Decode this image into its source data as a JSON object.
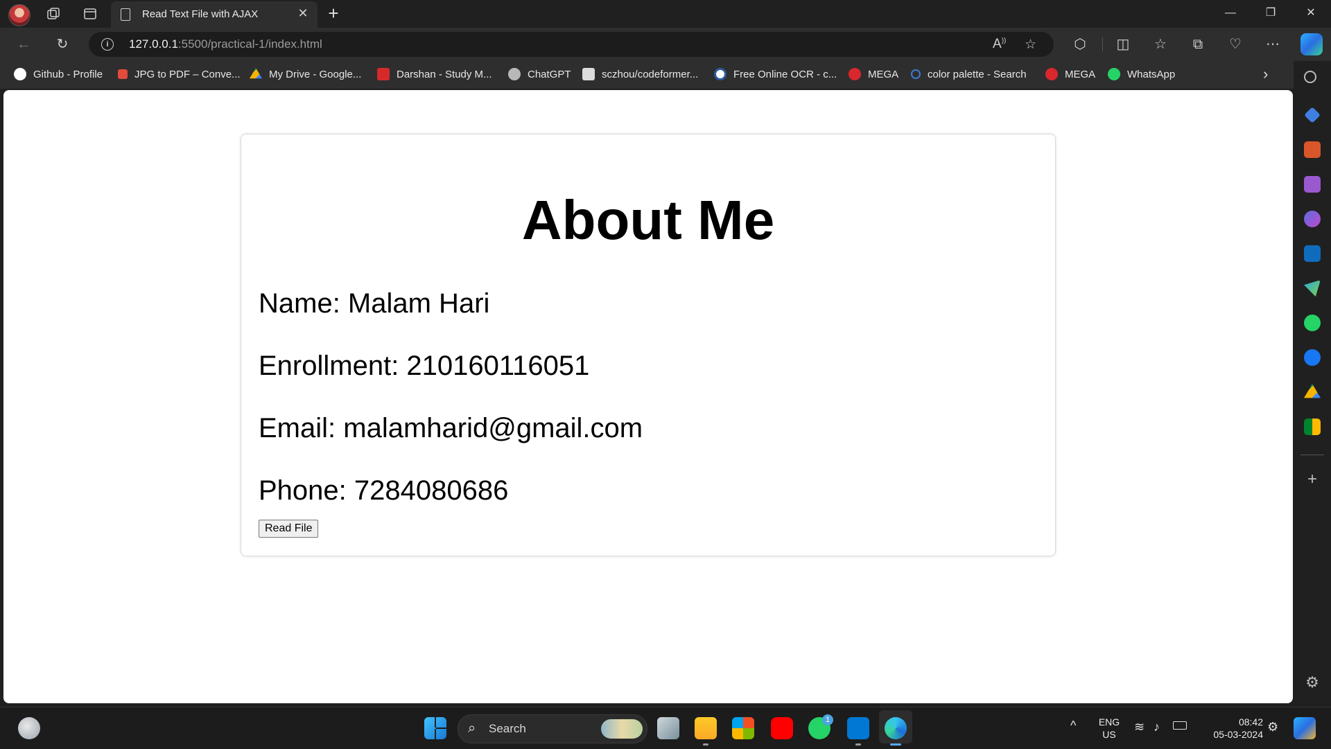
{
  "tab": {
    "title": "Read Text File with AJAX"
  },
  "address_bar": {
    "host": "127.0.0.1",
    "path": ":5500/practical-1/index.html"
  },
  "bookmarks": [
    {
      "label": "Github - Profile",
      "icon": "github-icon",
      "color": "#ffffff"
    },
    {
      "label": "JPG to PDF – Conve...",
      "icon": "pdf-icon",
      "color": "#e34b3c"
    },
    {
      "label": "My Drive - Google...",
      "icon": "google-drive-icon",
      "color": "#f4b400"
    },
    {
      "label": "Darshan - Study M...",
      "icon": "darshan-icon",
      "color": "#d62a2a"
    },
    {
      "label": "ChatGPT",
      "icon": "chatgpt-icon",
      "color": "#b8b8b8"
    },
    {
      "label": "sczhou/codeformer...",
      "icon": "codeformer-icon",
      "color": "#dcdcdc"
    },
    {
      "label": "Free Online OCR - c...",
      "icon": "ocr-icon",
      "color": "#2c5aa0"
    },
    {
      "label": "MEGA",
      "icon": "mega-icon",
      "color": "#d9272e"
    },
    {
      "label": "color palette - Search",
      "icon": "search-icon",
      "color": "#3a7bd5"
    },
    {
      "label": "MEGA",
      "icon": "mega-icon",
      "color": "#d9272e"
    },
    {
      "label": "WhatsApp",
      "icon": "whatsapp-icon",
      "color": "#25d366"
    }
  ],
  "page": {
    "heading": "About Me",
    "name_line": "Name: Malam Hari",
    "enrollment_line": "Enrollment: 210160116051",
    "email_line": "Email: malamharid@gmail.com",
    "phone_line": "Phone: 7284080686",
    "button_label": "Read File"
  },
  "taskbar": {
    "search_label": "Search",
    "language": "ENG",
    "region": "US",
    "time": "08:42",
    "date": "05-03-2024",
    "whatsapp_badge": "1"
  }
}
